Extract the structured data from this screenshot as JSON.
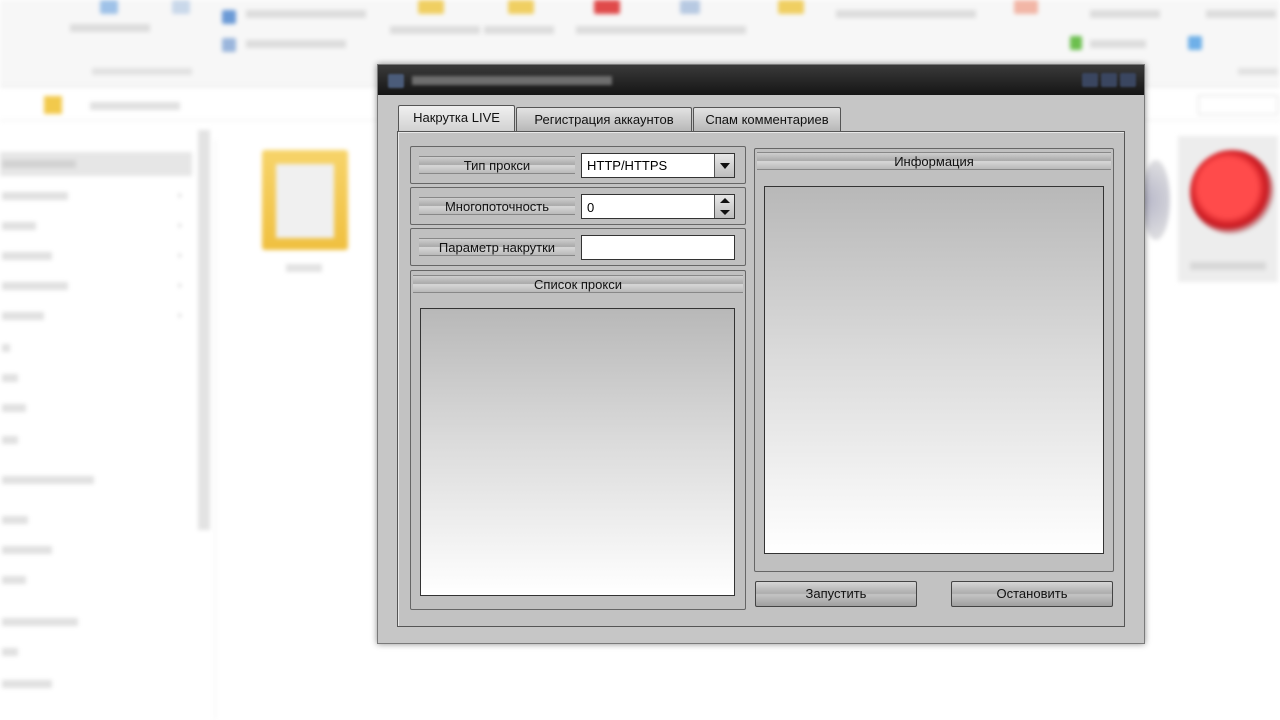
{
  "window": {
    "tabs": [
      {
        "label": "Накрутка LIVE",
        "active": true
      },
      {
        "label": "Регистрация аккаунтов",
        "active": false
      },
      {
        "label": "Спам комментариев",
        "active": false
      }
    ],
    "proxy_type": {
      "label": "Тип прокси",
      "value": "HTTP/HTTPS"
    },
    "threads": {
      "label": "Многопоточность",
      "value": "0"
    },
    "boost_param": {
      "label": "Параметр накрутки",
      "value": ""
    },
    "proxy_list": {
      "title": "Список прокси"
    },
    "info": {
      "title": "Информация"
    },
    "start_button": "Запустить",
    "stop_button": "Остановить"
  },
  "colors": {
    "titlebar": "#1a1a1a",
    "window_bg": "#c6c6c6",
    "field_bg": "#ffffff"
  }
}
